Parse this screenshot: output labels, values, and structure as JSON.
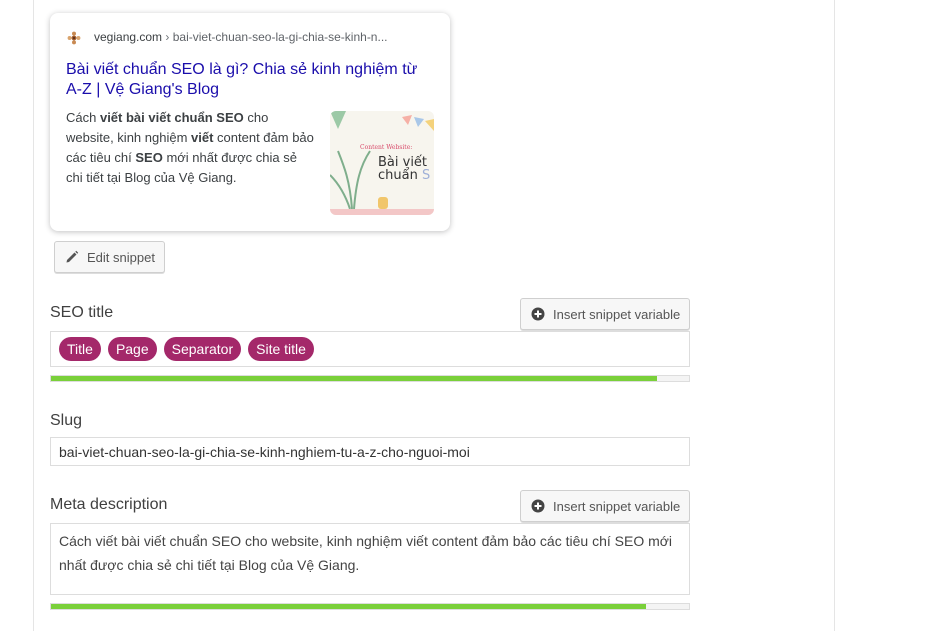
{
  "colors": {
    "link_blue": "#1a0dab",
    "variable_pill": "#a4286a",
    "progress_good": "#7ad03a"
  },
  "preview": {
    "domain": "vegiang.com",
    "separator": "›",
    "path": "bai-viet-chuan-seo-la-gi-chia-se-kinh-n...",
    "title": "Bài viết chuẩn SEO là gì? Chia sẻ kinh nghiệm từ A-Z | Vệ Giang's Blog",
    "desc_parts": [
      "Cách ",
      "viết bài viết chuẩn SEO",
      " cho website, kinh nghiệm ",
      "viết",
      " content đảm bảo các tiêu chí ",
      "SEO",
      " mới nhất được chia sẻ chi tiết tại Blog của Vệ Giang."
    ],
    "thumbnail": {
      "line1": "Content Website:",
      "line2": "Bài viết",
      "line3_a": "chuẩn",
      "line3_b": " S"
    },
    "favicon_icon": "flower-favicon-icon"
  },
  "edit_snippet": {
    "label": "Edit snippet",
    "icon": "pencil-icon"
  },
  "seo_title": {
    "label": "SEO title",
    "insert_label": "Insert snippet variable",
    "insert_icon": "plus-circle-icon",
    "variables": [
      "Title",
      "Page",
      "Separator",
      "Site title"
    ],
    "progress": 0.95
  },
  "slug": {
    "label": "Slug",
    "value": "bai-viet-chuan-seo-la-gi-chia-se-kinh-nghiem-tu-a-z-cho-nguoi-moi"
  },
  "meta_description": {
    "label": "Meta description",
    "insert_label": "Insert snippet variable",
    "insert_icon": "plus-circle-icon",
    "value": "Cách viết bài viết chuẩn SEO cho website, kinh nghiệm viết content đảm bảo các tiêu chí SEO mới nhất được chia sẻ chi tiết tại Blog của Vệ Giang.",
    "progress": 0.932
  }
}
